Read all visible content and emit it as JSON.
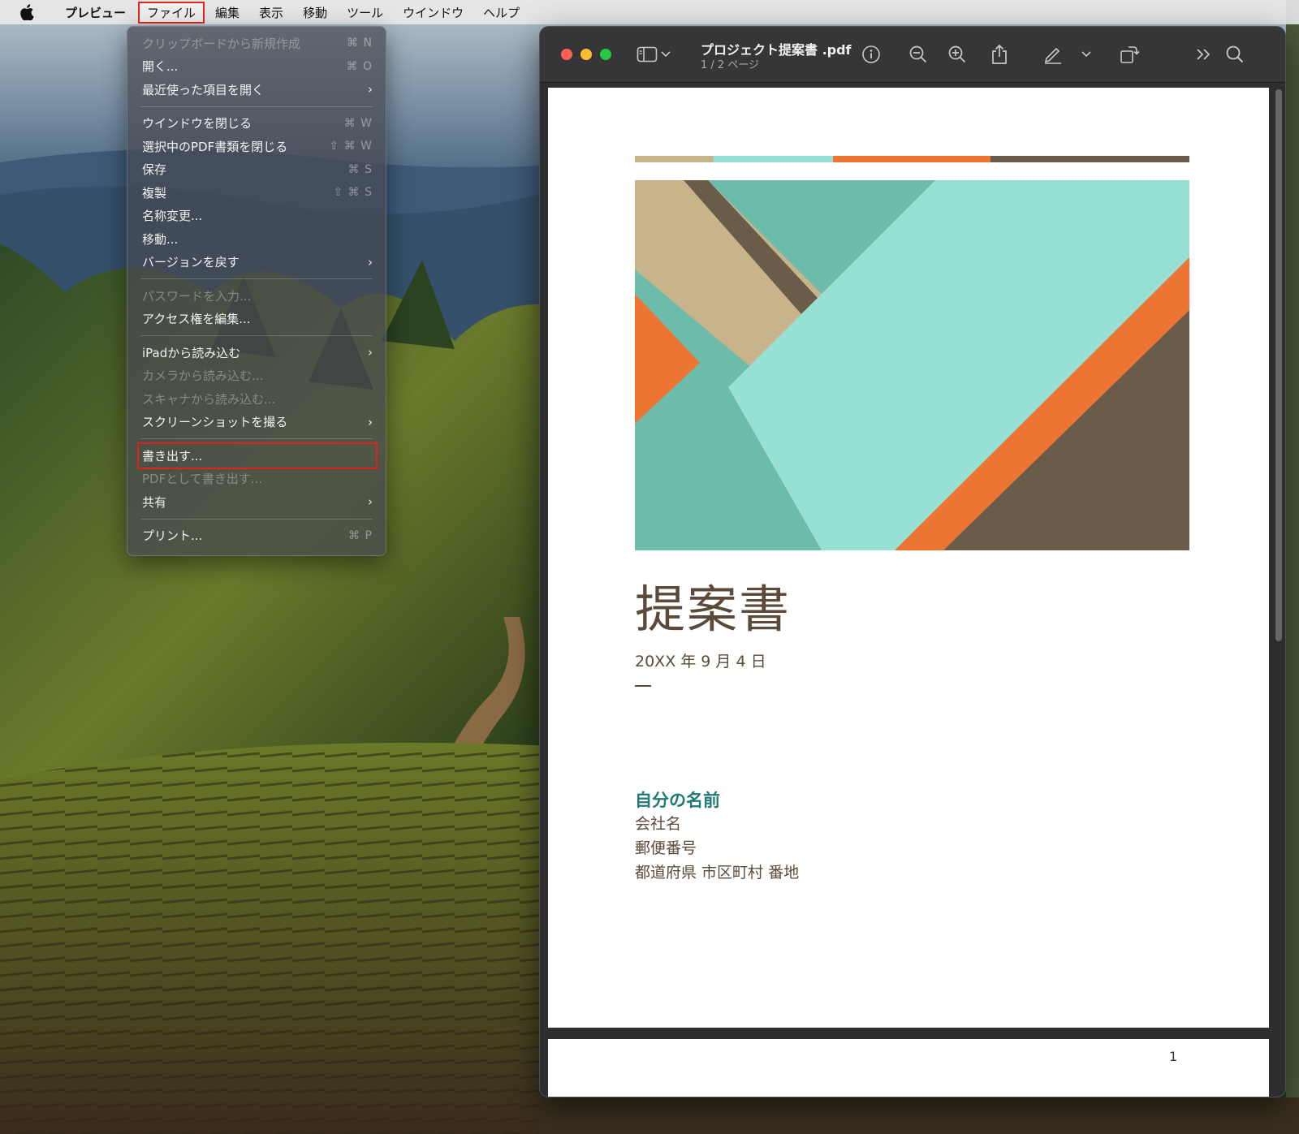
{
  "menubar": {
    "app_name": "プレビュー",
    "items": [
      "ファイル",
      "編集",
      "表示",
      "移動",
      "ツール",
      "ウインドウ",
      "ヘルプ"
    ]
  },
  "file_menu": {
    "items": [
      {
        "label": "クリップボードから新規作成",
        "shortcut": "⌘ N",
        "disabled": true
      },
      {
        "label": "開く...",
        "shortcut": "⌘ O"
      },
      {
        "label": "最近使った項目を開く",
        "submenu": true
      },
      {
        "separator": true
      },
      {
        "label": "ウインドウを閉じる",
        "shortcut": "⌘ W"
      },
      {
        "label": "選択中のPDF書類を閉じる",
        "shortcut": "⇧ ⌘ W"
      },
      {
        "label": "保存",
        "shortcut": "⌘ S"
      },
      {
        "label": "複製",
        "shortcut": "⇧ ⌘ S"
      },
      {
        "label": "名称変更..."
      },
      {
        "label": "移動..."
      },
      {
        "label": "バージョンを戻す",
        "submenu": true
      },
      {
        "separator": true
      },
      {
        "label": "パスワードを入力...",
        "disabled": true
      },
      {
        "label": "アクセス権を編集..."
      },
      {
        "separator": true
      },
      {
        "label": "iPadから読み込む",
        "submenu": true
      },
      {
        "label": "カメラから読み込む...",
        "disabled": true
      },
      {
        "label": "スキャナから読み込む...",
        "disabled": true
      },
      {
        "label": "スクリーンショットを撮る",
        "submenu": true
      },
      {
        "separator": true
      },
      {
        "label": "書き出す...",
        "highlight": true
      },
      {
        "label": "PDFとして書き出す...",
        "disabled": true
      },
      {
        "label": "共有",
        "submenu": true
      },
      {
        "separator": true
      },
      {
        "label": "プリント...",
        "shortcut": "⌘ P"
      }
    ]
  },
  "window": {
    "title": "プロジェクト提案書 .pdf",
    "page_indicator": "1 / 2 ページ"
  },
  "document": {
    "title": "提案書",
    "date": "20XX 年 9 月 4 日",
    "name": "自分の名前",
    "lines": [
      "会社名",
      "郵便番号",
      "都道府県 市区町村 番地"
    ],
    "page_number": "1"
  },
  "colors": {
    "tan": "#c7b48a",
    "teal_light": "#98e0d3",
    "teal": "#6dbbab",
    "orange": "#ee7433",
    "brown": "#6b5c49",
    "name_teal": "#1f7a74",
    "highlight_red": "#e0231c"
  },
  "icons": [
    "apple-icon",
    "sidebar-icon",
    "chevron-down-icon",
    "info-icon",
    "zoom-out-icon",
    "zoom-in-icon",
    "share-icon",
    "markup-icon",
    "rotate-icon",
    "more-icon",
    "search-icon"
  ]
}
